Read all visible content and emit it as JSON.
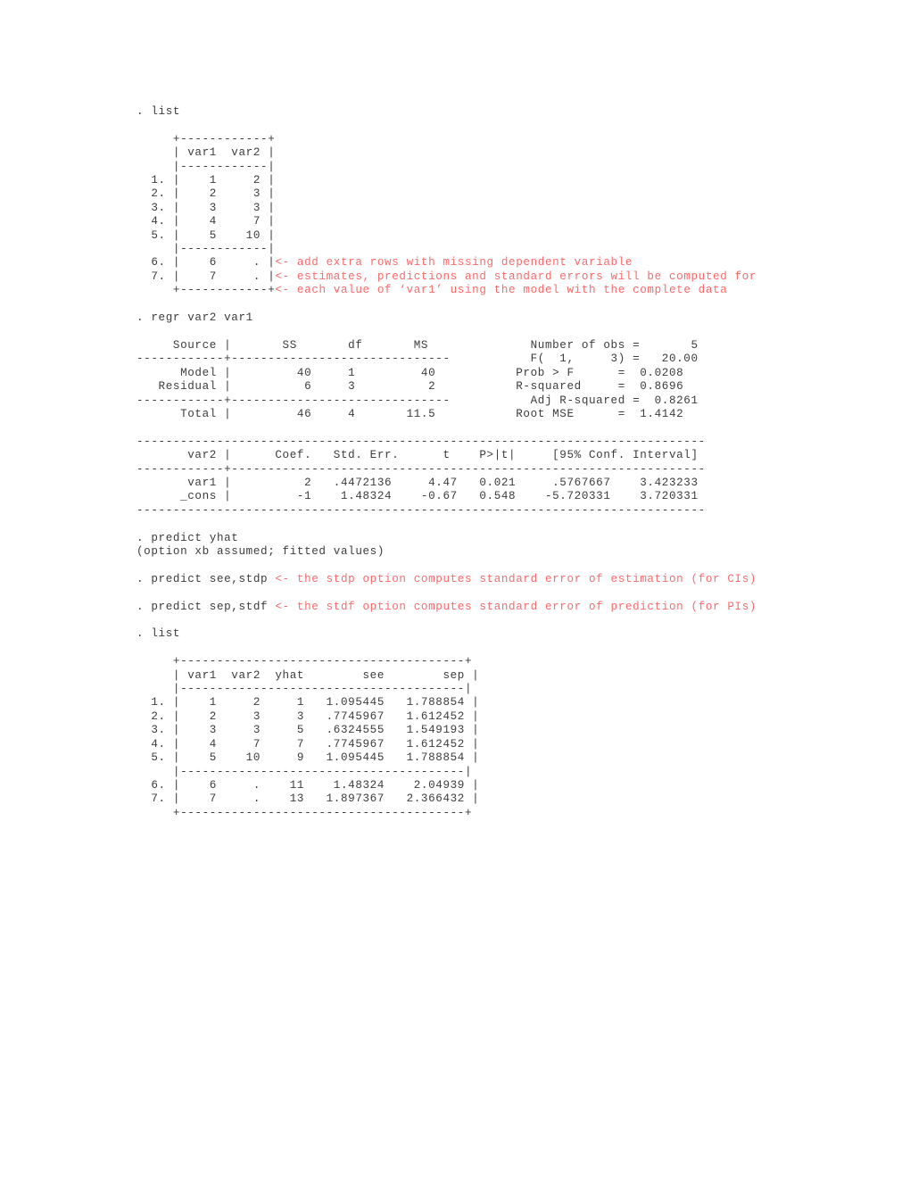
{
  "document": {
    "kind": "stata-console-log",
    "background_color": "#ffffff",
    "text_color": "#3c3c3c",
    "annotation_color": "#fa6a6c"
  },
  "lines": [
    {
      "black": ". list",
      "red": ""
    },
    {
      "black": "",
      "red": ""
    },
    {
      "black": "     +------------+",
      "red": ""
    },
    {
      "black": "     | var1  var2 |",
      "red": ""
    },
    {
      "black": "     |------------|",
      "red": ""
    },
    {
      "black": "  1. |    1     2 |",
      "red": ""
    },
    {
      "black": "  2. |    2     3 |",
      "red": ""
    },
    {
      "black": "  3. |    3     3 |",
      "red": ""
    },
    {
      "black": "  4. |    4     7 |",
      "red": ""
    },
    {
      "black": "  5. |    5    10 |",
      "red": ""
    },
    {
      "black": "     |------------|",
      "red": ""
    },
    {
      "black": "  6. |    6     . |",
      "red": "<- add extra rows with missing dependent variable"
    },
    {
      "black": "  7. |    7     . |",
      "red": "<- estimates, predictions and standard errors will be computed for"
    },
    {
      "black": "     +------------+",
      "red": "<- each value of ‘var1’ using the model with the complete data"
    },
    {
      "black": "",
      "red": ""
    },
    {
      "black": ". regr var2 var1",
      "red": ""
    },
    {
      "black": "",
      "red": ""
    },
    {
      "black": "     Source |       SS       df       MS              Number of obs =       5",
      "red": ""
    },
    {
      "black": "------------+------------------------------           F(  1,     3) =   20.00",
      "red": ""
    },
    {
      "black": "      Model |         40     1         40           Prob > F      =  0.0208",
      "red": ""
    },
    {
      "black": "   Residual |          6     3          2           R-squared     =  0.8696",
      "red": ""
    },
    {
      "black": "------------+------------------------------           Adj R-squared =  0.8261",
      "red": ""
    },
    {
      "black": "      Total |         46     4       11.5           Root MSE      =  1.4142",
      "red": ""
    },
    {
      "black": "",
      "red": ""
    },
    {
      "black": "------------------------------------------------------------------------------",
      "red": ""
    },
    {
      "black": "       var2 |      Coef.   Std. Err.      t    P>|t|     [95% Conf. Interval]",
      "red": ""
    },
    {
      "black": "------------+-----------------------------------------------------------------",
      "red": ""
    },
    {
      "black": "       var1 |          2   .4472136     4.47   0.021     .5767667    3.423233",
      "red": ""
    },
    {
      "black": "      _cons |         -1    1.48324    -0.67   0.548    -5.720331    3.720331",
      "red": ""
    },
    {
      "black": "------------------------------------------------------------------------------",
      "red": ""
    },
    {
      "black": "",
      "red": ""
    },
    {
      "black": ". predict yhat",
      "red": ""
    },
    {
      "black": "(option xb assumed; fitted values)",
      "red": ""
    },
    {
      "black": "",
      "red": ""
    },
    {
      "black": ". predict see,stdp ",
      "red": "<- the stdp option computes standard error of estimation (for CIs)"
    },
    {
      "black": "",
      "red": ""
    },
    {
      "black": ". predict sep,stdf ",
      "red": "<- the stdf option computes standard error of prediction (for PIs)"
    },
    {
      "black": "",
      "red": ""
    },
    {
      "black": ". list",
      "red": ""
    },
    {
      "black": "",
      "red": ""
    },
    {
      "black": "     +---------------------------------------+",
      "red": ""
    },
    {
      "black": "     | var1  var2  yhat        see        sep |",
      "red": ""
    },
    {
      "black": "     |---------------------------------------|",
      "red": ""
    },
    {
      "black": "  1. |    1     2     1   1.095445   1.788854 |",
      "red": ""
    },
    {
      "black": "  2. |    2     3     3   .7745967   1.612452 |",
      "red": ""
    },
    {
      "black": "  3. |    3     3     5   .6324555   1.549193 |",
      "red": ""
    },
    {
      "black": "  4. |    4     7     7   .7745967   1.612452 |",
      "red": ""
    },
    {
      "black": "  5. |    5    10     9   1.095445   1.788854 |",
      "red": ""
    },
    {
      "black": "     |---------------------------------------|",
      "red": ""
    },
    {
      "black": "  6. |    6     .    11    1.48324    2.04939 |",
      "red": ""
    },
    {
      "black": "  7. |    7     .    13   1.897367   2.366432 |",
      "red": ""
    },
    {
      "black": "     +---------------------------------------+",
      "red": ""
    }
  ],
  "content_detail": {
    "commands": [
      ". list",
      ". regr var2 var1",
      ". predict yhat",
      ". predict see,stdp",
      ". predict sep,stdf",
      ". list"
    ],
    "predict_yhat_message": "(option xb assumed; fitted values)",
    "annotations": [
      "<- add extra rows with missing dependent variable",
      "<- estimates, predictions and standard errors will be computed for",
      "<- each value of ‘var1’ using the model with the complete data",
      "<- the stdp option computes standard error of estimation (for CIs)",
      "<- the stdf option computes standard error of prediction (for PIs)"
    ],
    "first_list": {
      "columns": [
        "var1",
        "var2"
      ],
      "rows": [
        {
          "n": "1.",
          "var1": "1",
          "var2": "2"
        },
        {
          "n": "2.",
          "var1": "2",
          "var2": "3"
        },
        {
          "n": "3.",
          "var1": "3",
          "var2": "3"
        },
        {
          "n": "4.",
          "var1": "4",
          "var2": "7"
        },
        {
          "n": "5.",
          "var1": "5",
          "var2": "10"
        },
        {
          "n": "6.",
          "var1": "6",
          "var2": "."
        },
        {
          "n": "7.",
          "var1": "7",
          "var2": "."
        }
      ]
    },
    "regression": {
      "anova_headers": [
        "Source",
        "SS",
        "df",
        "MS"
      ],
      "anova_rows": [
        {
          "source": "Model",
          "ss": "40",
          "df": "1",
          "ms": "40"
        },
        {
          "source": "Residual",
          "ss": "6",
          "df": "3",
          "ms": "2"
        },
        {
          "source": "Total",
          "ss": "46",
          "df": "4",
          "ms": "11.5"
        }
      ],
      "stats": [
        {
          "label": "Number of obs =",
          "value": "5"
        },
        {
          "label": "F(  1,     3) =",
          "value": "20.00"
        },
        {
          "label": "Prob > F      =",
          "value": "0.0208"
        },
        {
          "label": "R-squared     =",
          "value": "0.8696"
        },
        {
          "label": "Adj R-squared =",
          "value": "0.8261"
        },
        {
          "label": "Root MSE      =",
          "value": "1.4142"
        }
      ],
      "coef_headers": [
        "var2",
        "Coef.",
        "Std. Err.",
        "t",
        "P>|t|",
        "[95% Conf. Interval]"
      ],
      "coef_rows": [
        {
          "term": "var1",
          "coef": "2",
          "se": ".4472136",
          "t": "4.47",
          "p": "0.021",
          "ci_low": ".5767667",
          "ci_high": "3.423233"
        },
        {
          "term": "_cons",
          "coef": "-1",
          "se": "1.48324",
          "t": "-0.67",
          "p": "0.548",
          "ci_low": "-5.720331",
          "ci_high": "3.720331"
        }
      ]
    },
    "second_list": {
      "columns": [
        "var1",
        "var2",
        "yhat",
        "see",
        "sep"
      ],
      "rows": [
        {
          "n": "1.",
          "var1": "1",
          "var2": "2",
          "yhat": "1",
          "see": "1.095445",
          "sep": "1.788854"
        },
        {
          "n": "2.",
          "var1": "2",
          "var2": "3",
          "yhat": "3",
          "see": ".7745967",
          "sep": "1.612452"
        },
        {
          "n": "3.",
          "var1": "3",
          "var2": "3",
          "yhat": "5",
          "see": ".6324555",
          "sep": "1.549193"
        },
        {
          "n": "4.",
          "var1": "4",
          "var2": "7",
          "yhat": "7",
          "see": ".7745967",
          "sep": "1.612452"
        },
        {
          "n": "5.",
          "var1": "5",
          "var2": "10",
          "yhat": "9",
          "see": "1.095445",
          "sep": "1.788854"
        },
        {
          "n": "6.",
          "var1": "6",
          "var2": ".",
          "yhat": "11",
          "see": "1.48324",
          "sep": "2.04939"
        },
        {
          "n": "7.",
          "var1": "7",
          "var2": ".",
          "yhat": "13",
          "see": "1.897367",
          "sep": "2.366432"
        }
      ]
    }
  }
}
